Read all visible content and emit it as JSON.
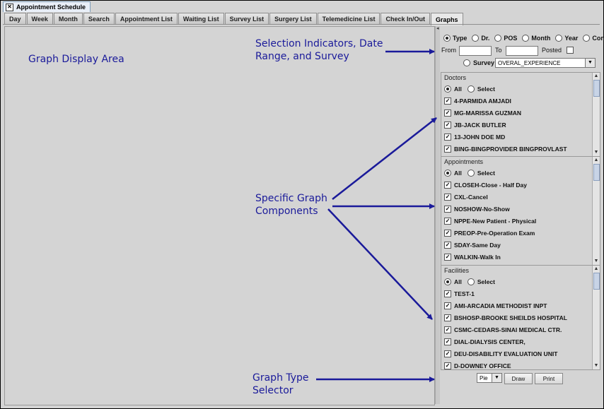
{
  "window": {
    "title": "Appointment Schedule"
  },
  "tabs": [
    "Day",
    "Week",
    "Month",
    "Search",
    "Appointment List",
    "Waiting List",
    "Survey List",
    "Surgery List",
    "Telemedicine List",
    "Check In/Out",
    "Graphs"
  ],
  "annotations": {
    "graph_display_area": "Graph Display Area",
    "selection_1": "Selection Indicators, Date",
    "selection_2": "Range, and Survey",
    "components_1": "Specific Graph",
    "components_2": "Components",
    "selector_1": "Graph Type",
    "selector_2": "Selector"
  },
  "selection": {
    "radios": [
      "Type",
      "Dr.",
      "POS",
      "Month",
      "Year",
      "Confirm"
    ],
    "from_label": "From",
    "to_label": "To",
    "posted_label": "Posted",
    "survey_label": "Survey",
    "survey_value": "OVERAL_EXPERIENCE"
  },
  "doctors": {
    "title": "Doctors",
    "all": "All",
    "select": "Select",
    "items": [
      "4-PARMIDA AMJADI",
      "MG-MARISSA GUZMAN",
      "JB-JACK BUTLER",
      "13-JOHN DOE MD",
      "BING-BINGPROVIDER BINGPROVLAST"
    ]
  },
  "appointments": {
    "title": "Appointments",
    "all": "All",
    "select": "Select",
    "items": [
      "CLOSEH-Close - Half Day",
      "CXL-Cancel",
      "NOSHOW-No-Show",
      "NPPE-New Patient - Physical",
      "PREOP-Pre-Operation Exam",
      "SDAY-Same Day",
      "WALKIN-Walk In"
    ]
  },
  "facilities": {
    "title": "Facilities",
    "all": "All",
    "select": "Select",
    "items": [
      "TEST-1",
      "AMI-ARCADIA METHODIST INPT",
      "BSHOSP-BROOKE SHEILDS HOSPITAL",
      "CSMC-CEDARS-SINAI MEDICAL CTR.",
      "DIAL-DIALYSIS CENTER,",
      "DEU-DISABILITY EVALUATION UNIT",
      "D-DOWNEY OFFICE"
    ]
  },
  "bottom": {
    "graph_type": "Pie",
    "draw": "Draw",
    "print": "Print"
  },
  "colors": {
    "annotation": "#1a1a9a",
    "arrow": "#1a1a9a"
  }
}
